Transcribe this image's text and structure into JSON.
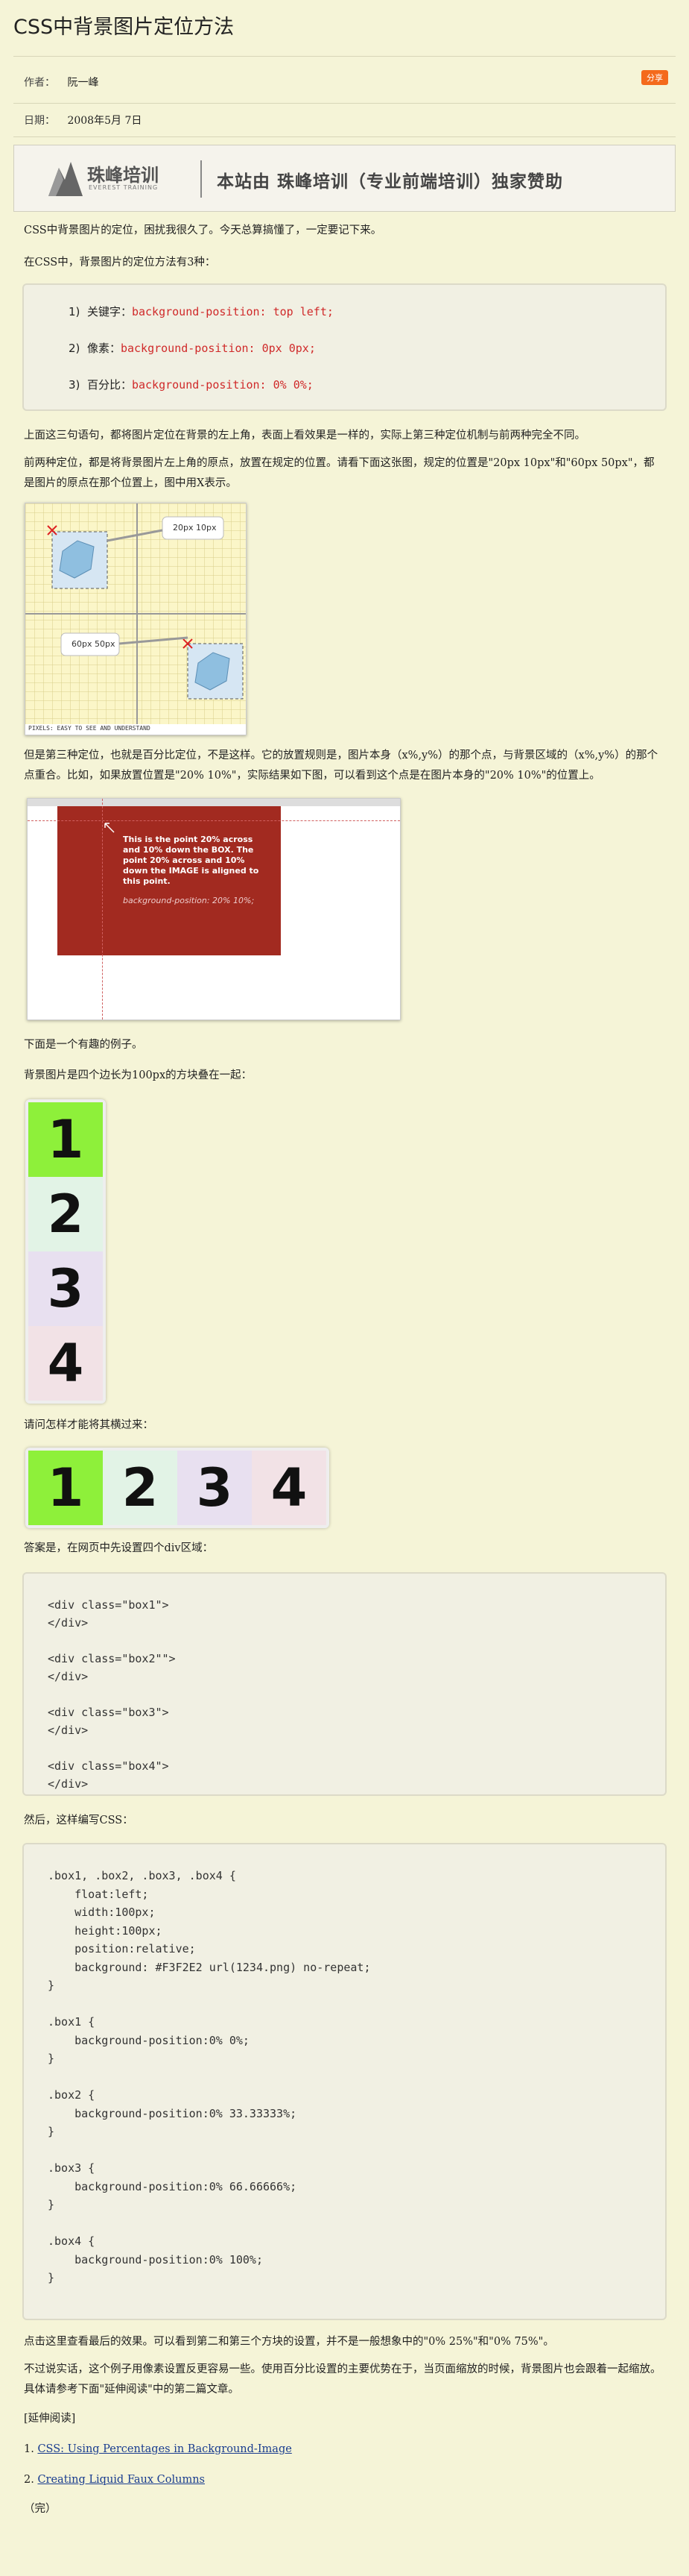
{
  "header": {
    "title": "CSS中背景图片定位方法"
  },
  "meta": {
    "author_label": "作者：",
    "author": "阮一峰",
    "date_label": "日期：",
    "date": "2008年5月 7日",
    "share_label": "分享"
  },
  "banner": {
    "logo_cn": "珠峰培训",
    "logo_en": "EVEREST TRAINING",
    "slogan": "本站由 珠峰培训（专业前端培训）独家赞助"
  },
  "text": {
    "p1": "CSS中背景图片的定位，困扰我很久了。今天总算搞懂了，一定要记下来。",
    "p2": "在CSS中，背景图片的定位方法有3种：",
    "methods": [
      {
        "num": "1)",
        "name": "关键字：",
        "code": "background-position: top left;"
      },
      {
        "num": "2)",
        "name": "像素：",
        "code": "background-position: 0px 0px;"
      },
      {
        "num": "3)",
        "name": "百分比：",
        "code": "background-position: 0% 0%;"
      }
    ],
    "p3": "上面这三句语句，都将图片定位在背景的左上角，表面上看效果是一样的，实际上第三种定位机制与前两种完全不同。",
    "p4": "前两种定位，都是将背景图片左上角的原点，放置在规定的位置。请看下面这张图，规定的位置是\"20px 10px\"和\"60px 50px\"，都是图片的原点在那个位置上，图中用X表示。",
    "p5": "但是第三种定位，也就是百分比定位，不是这样。它的放置规则是，图片本身（x%,y%）的那个点，与背景区域的（x%,y%）的那个点重合。比如，如果放置位置是\"20% 10%\"，实际结果如下图，可以看到这个点是在图片本身的\"20% 10%\"的位置上。",
    "p6": "下面是一个有趣的例子。",
    "p7": "背景图片是四个边长为100px的方块叠在一起：",
    "p8": "请问怎样才能将其横过来：",
    "p9": "答案是，在网页中先设置四个div区域：",
    "p10": "然后，这样编写CSS：",
    "p11": "点击这里查看最后的效果。可以看到第二和第三个方块的设置，并不是一般想象中的\"0% 25%\"和\"0% 75%\"。",
    "p12": "不过说实话，这个例子用像素设置反更容易一些。使用百分比设置的主要优势在于，当页面缩放的时候，背景图片也会跟着一起缩放。具体请参考下面\"延伸阅读\"中的第二篇文章。",
    "further": "[延伸阅读]",
    "links": [
      {
        "num": "1.",
        "label": "CSS: Using Percentages in Background-Image"
      },
      {
        "num": "2.",
        "label": "Creating Liquid Faux Columns"
      }
    ],
    "end": "（完）"
  },
  "figure1": {
    "label1": "20px 10px",
    "label2": "60px 50px",
    "caption": "PIXELS: EASY TO SEE AND UNDERSTAND"
  },
  "figure2": {
    "lines": [
      "This is the point 20% across",
      "and 10% down the BOX. The",
      "point 20% across and 10%",
      "down the IMAGE is aligned to",
      "this point."
    ],
    "code": "background-position: 20% 10%;"
  },
  "squares": [
    {
      "n": "1",
      "color": "#8ef03a"
    },
    {
      "n": "2",
      "color": "#e2f3e6"
    },
    {
      "n": "3",
      "color": "#e8e0f0"
    },
    {
      "n": "4",
      "color": "#f2e2e6"
    }
  ],
  "divs": [
    "<div class=\"box1\">",
    "</div>",
    "<div class=\"box2\"\">",
    "</div>",
    "<div class=\"box3\">",
    "</div>",
    "<div class=\"box4\">",
    "</div>"
  ],
  "css": [
    ".box1, .box2, .box3, .box4 {",
    "    float:left;",
    "    width:100px;",
    "    height:100px;",
    "    position:relative;",
    "    background: #F3F2E2 url(1234.png) no-repeat;",
    "}",
    "",
    ".box1 {",
    "    background-position:0% 0%;",
    "}",
    "",
    ".box2 {",
    "    background-position:0% 33.33333%;",
    "}",
    "",
    ".box3 {",
    "    background-position:0% 66.66666%;",
    "}",
    "",
    ".box4 {",
    "    background-position:0% 100%;",
    "}"
  ]
}
